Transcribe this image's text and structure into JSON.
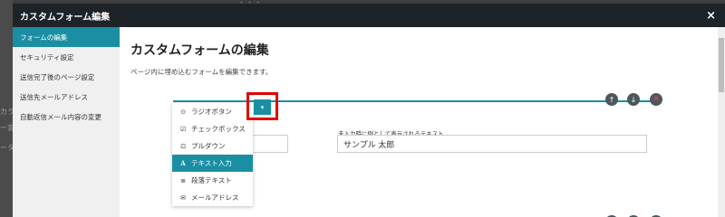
{
  "modal": {
    "title": "カスタムフォーム編集",
    "close_glyph": "×"
  },
  "sidebar": {
    "items": [
      {
        "label": "フォームの編集",
        "active": true
      },
      {
        "label": "セキュリティ設定",
        "active": false
      },
      {
        "label": "送信完了後のページ設定",
        "active": false
      },
      {
        "label": "送信先メールアドレス",
        "active": false
      },
      {
        "label": "自動返信メール内容の変更",
        "active": false
      }
    ]
  },
  "main": {
    "title": "カスタムフォームの編集",
    "description": "ページ内に埋め込むフォームを編集できます。"
  },
  "field_type_menu": {
    "toggle_glyph": "▾",
    "items": [
      {
        "icon": "radio-icon",
        "glyph": "⊙",
        "label": "ラジオボタン"
      },
      {
        "icon": "checkbox-icon",
        "glyph": "☑",
        "label": "チェックボックス"
      },
      {
        "icon": "select-icon",
        "glyph": "⊡",
        "label": "プルダウン"
      },
      {
        "icon": "text-icon",
        "glyph": "A",
        "label": "テキスト入力",
        "selected": true
      },
      {
        "icon": "paragraph-icon",
        "glyph": "≣",
        "label": "段落テキスト"
      },
      {
        "icon": "mail-icon",
        "glyph": "✉",
        "label": "メールアドレス"
      }
    ]
  },
  "field": {
    "placeholder_label": "未入力時に例として表示されるテキスト",
    "placeholder_value": "サンプル 太郎"
  },
  "controls": {
    "up_glyph": "↑",
    "down_glyph": "↓",
    "delete_glyph": "✕"
  },
  "colors": {
    "accent": "#1a8fa3",
    "header": "#1d2327",
    "highlight": "#e10000",
    "delete": "#e54b4b"
  }
}
